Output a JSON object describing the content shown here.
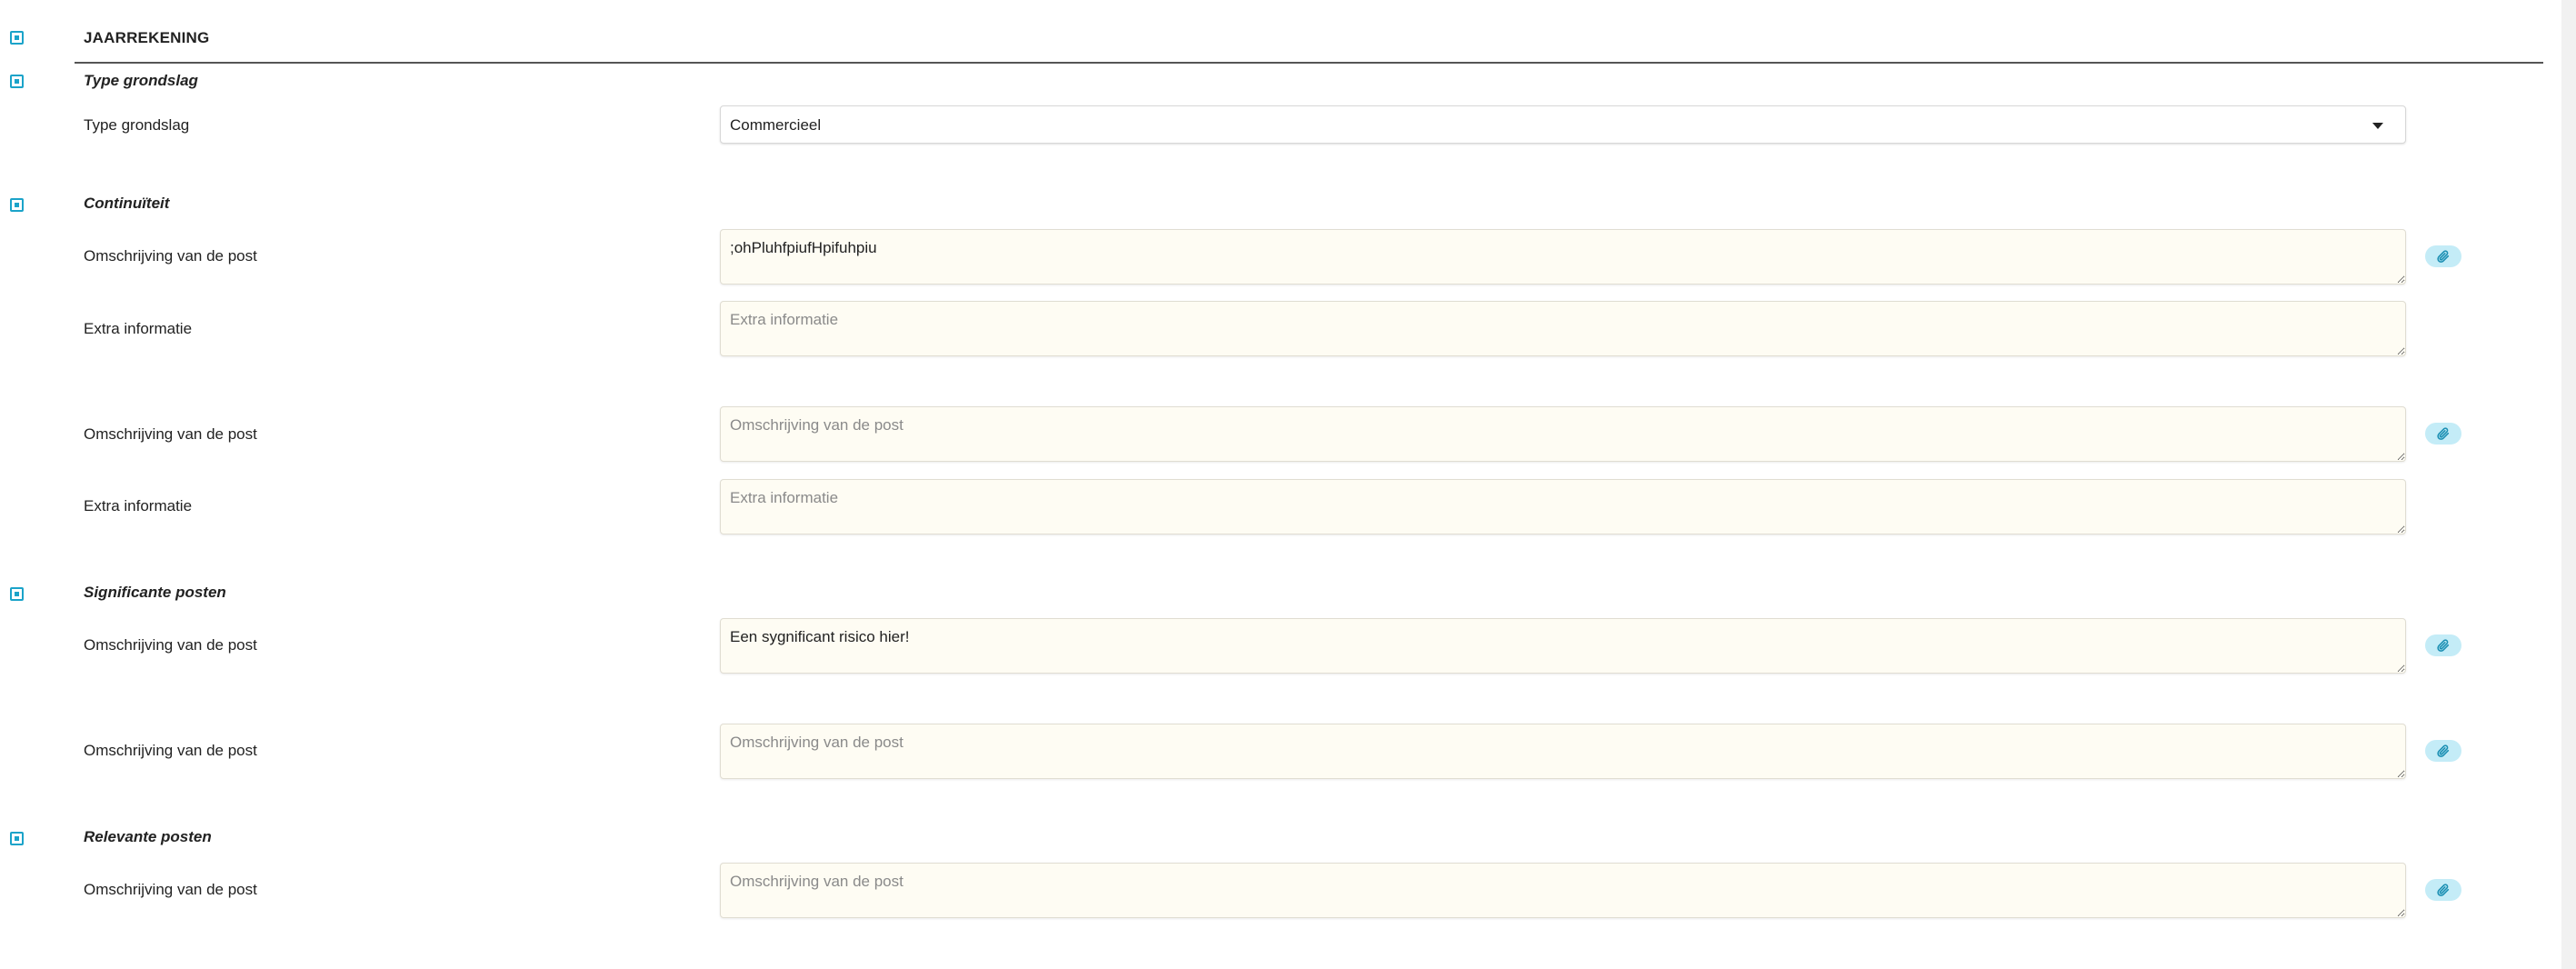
{
  "header": {
    "title": "JAARREKENING"
  },
  "sections": {
    "type_grondslag": {
      "title": "Type grondslag",
      "field_label": "Type grondslag",
      "select_value": "Commercieel"
    },
    "continuiteit": {
      "title": "Continuïteit",
      "rows": [
        {
          "label": "Omschrijving van de post",
          "value": ";ohPluhfpiufHpifuhpiu",
          "placeholder": "Omschrijving van de post"
        },
        {
          "label": "Extra informatie",
          "value": "",
          "placeholder": "Extra informatie"
        },
        {
          "label": "Omschrijving van de post",
          "value": "",
          "placeholder": "Omschrijving van de post"
        },
        {
          "label": "Extra informatie",
          "value": "",
          "placeholder": "Extra informatie"
        }
      ]
    },
    "significante_posten": {
      "title": "Significante posten",
      "rows": [
        {
          "label": "Omschrijving van de post",
          "value": "Een sygnificant risico hier!",
          "placeholder": "Omschrijving van de post"
        },
        {
          "label": "Omschrijving van de post",
          "value": "",
          "placeholder": "Omschrijving van de post"
        }
      ]
    },
    "relevante_posten": {
      "title": "Relevante posten",
      "rows": [
        {
          "label": "Omschrijving van de post",
          "value": "",
          "placeholder": "Omschrijving van de post"
        }
      ]
    }
  },
  "icons": {
    "attach": "paperclip-icon",
    "checkbox": "checked-checkbox"
  },
  "colors": {
    "accent": "#1ba3c9",
    "attach_bg": "#c4ecf7",
    "field_bg": "#fefcf3"
  }
}
